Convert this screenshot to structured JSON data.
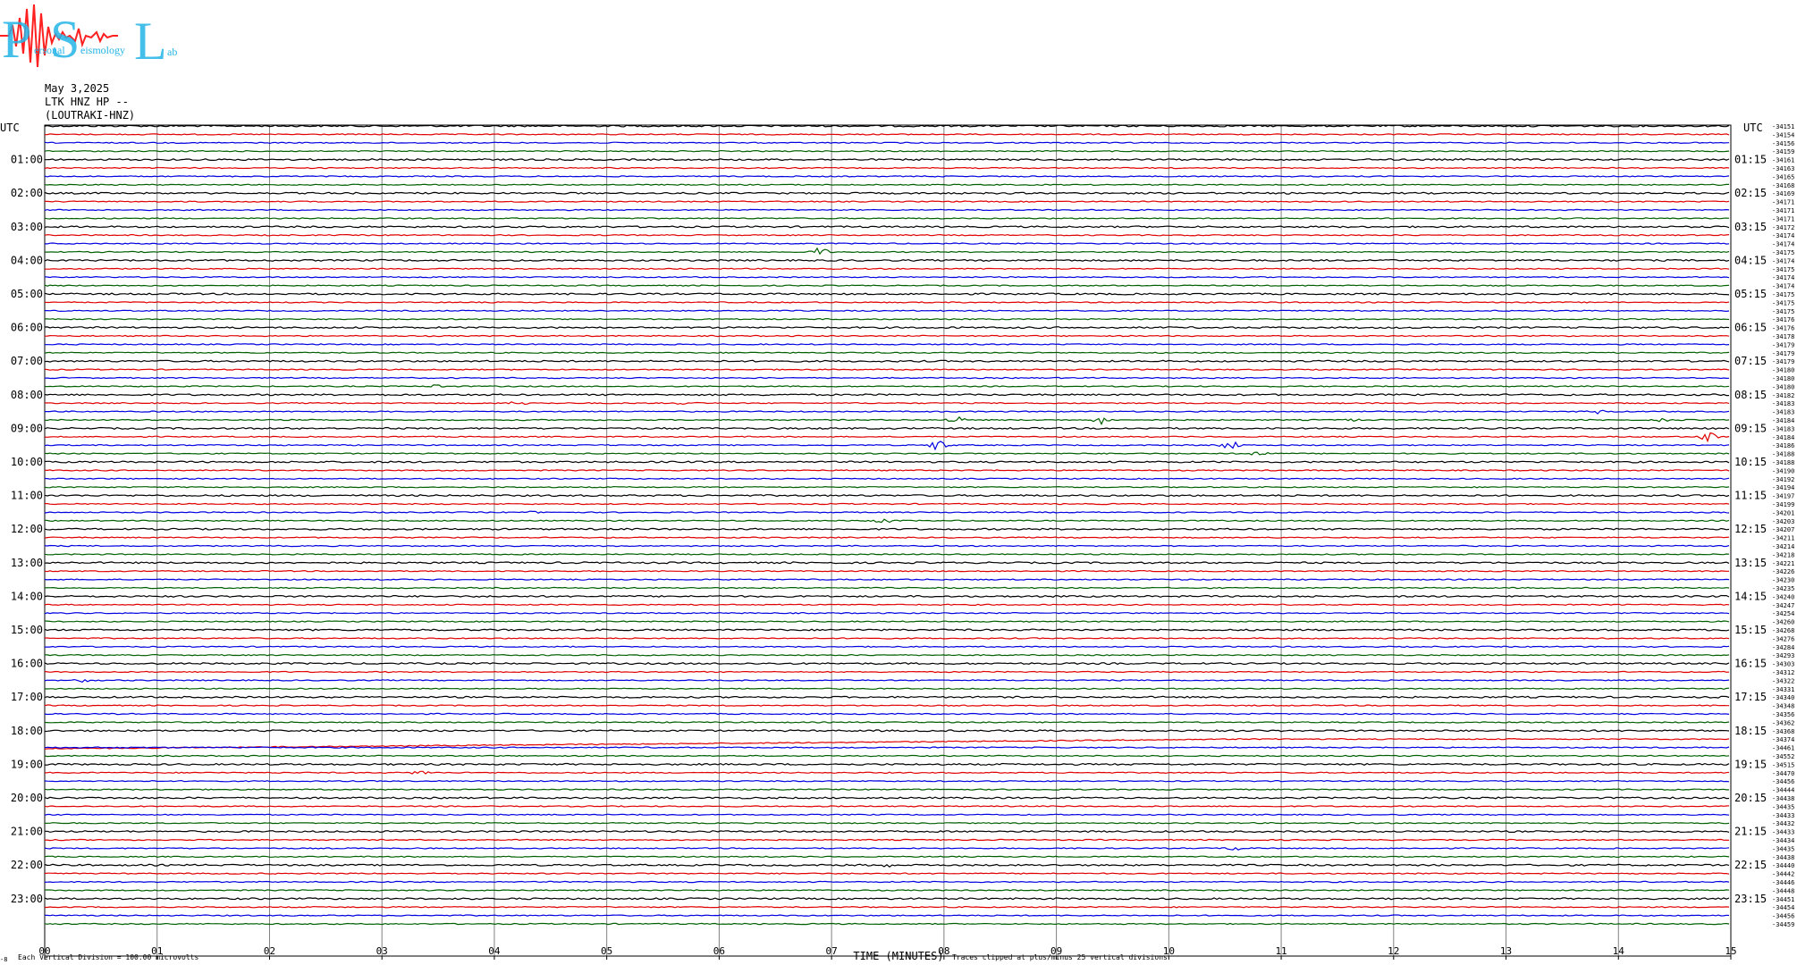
{
  "logo": {
    "letters": [
      "P",
      "S",
      "L"
    ],
    "words": [
      "ersonal",
      "eismology",
      "ab"
    ]
  },
  "header": {
    "date": "May 3,2025",
    "station": "LTK HNZ HP --",
    "location": "(LOUTRAKI-HNZ)"
  },
  "footer": {
    "xlabel": "TIME (MINUTES)",
    "scale_note": "Each Vertical Division =  100.00 microvolts",
    "clip_note": "Traces clipped at plus/minus 25 vertical divisions",
    "corner_mark": "-8"
  },
  "colors": {
    "cycle": [
      "#000000",
      "#e00000",
      "#0000e0",
      "#006000"
    ],
    "grid": "#808080",
    "logo_blue": "#22b4e6",
    "logo_red": "#ff2020"
  },
  "chart_data": {
    "type": "line",
    "subtype": "helicorder",
    "title": "",
    "xlabel": "TIME (MINUTES)",
    "ylabel": "",
    "xlim": [
      0,
      15
    ],
    "x_tick_labels": [
      "00",
      "01",
      "02",
      "03",
      "04",
      "05",
      "06",
      "07",
      "08",
      "09",
      "10",
      "11",
      "12",
      "13",
      "14",
      "15"
    ],
    "grid": true,
    "left_axis_header": "UTC",
    "right_axis_header": "UTC",
    "left_hour_labels": [
      "01:00",
      "02:00",
      "03:00",
      "04:00",
      "05:00",
      "06:00",
      "07:00",
      "08:00",
      "09:00",
      "10:00",
      "11:00",
      "12:00",
      "13:00",
      "14:00",
      "15:00",
      "16:00",
      "17:00",
      "18:00",
      "19:00",
      "20:00",
      "21:00",
      "22:00",
      "23:00"
    ],
    "right_hour_labels": [
      "01:15",
      "02:15",
      "03:15",
      "04:15",
      "05:15",
      "06:15",
      "07:15",
      "08:15",
      "09:15",
      "10:15",
      "11:15",
      "12:15",
      "13:15",
      "14:15",
      "15:15",
      "16:15",
      "17:15",
      "18:15",
      "19:15",
      "20:15",
      "21:15",
      "22:15",
      "23:15"
    ],
    "trace_count": 96,
    "trace_minutes": 15,
    "trace_offsets": [
      "-34151",
      "-34154",
      "-34156",
      "-34159",
      "-34161",
      "-34163",
      "-34165",
      "-34168",
      "-34169",
      "-34171",
      "-34171",
      "-34171",
      "-34172",
      "-34174",
      "-34174",
      "-34175",
      "-34174",
      "-34175",
      "-34174",
      "-34174",
      "-34175",
      "-34175",
      "-34175",
      "-34176",
      "-34176",
      "-34178",
      "-34179",
      "-34179",
      "-34179",
      "-34180",
      "-34180",
      "-34180",
      "-34182",
      "-34183",
      "-34183",
      "-34184",
      "-34183",
      "-34184",
      "-34186",
      "-34188",
      "-34188",
      "-34190",
      "-34192",
      "-34194",
      "-34197",
      "-34199",
      "-34201",
      "-34203",
      "-34207",
      "-34211",
      "-34214",
      "-34218",
      "-34221",
      "-34226",
      "-34230",
      "-34235",
      "-34240",
      "-34247",
      "-34254",
      "-34260",
      "-34268",
      "-34276",
      "-34284",
      "-34293",
      "-34303",
      "-34312",
      "-34322",
      "-34331",
      "-34340",
      "-34348",
      "-34356",
      "-34362",
      "-34368",
      "-34374",
      "-34461",
      "-34552",
      "-34515",
      "-34470",
      "-34456",
      "-34444",
      "-34438",
      "-34435",
      "-34433",
      "-34432",
      "-34433",
      "-34434",
      "-34435",
      "-34438",
      "-34440",
      "-34442",
      "-34446",
      "-34448",
      "-34451",
      "-34454",
      "-34456",
      "-34459"
    ],
    "events": [
      {
        "trace": 15,
        "minute": 6.9,
        "amplitude": 6
      },
      {
        "trace": 31,
        "minute": 3.5,
        "amplitude": 2
      },
      {
        "trace": 33,
        "minute": 4.2,
        "amplitude": 3
      },
      {
        "trace": 33,
        "minute": 5.7,
        "amplitude": 2
      },
      {
        "trace": 34,
        "minute": 13.8,
        "amplitude": 3
      },
      {
        "trace": 35,
        "minute": 8.1,
        "amplitude": 4
      },
      {
        "trace": 35,
        "minute": 9.4,
        "amplitude": 5
      },
      {
        "trace": 35,
        "minute": 11.6,
        "amplitude": 2
      },
      {
        "trace": 35,
        "minute": 14.4,
        "amplitude": 2
      },
      {
        "trace": 37,
        "minute": 14.8,
        "amplitude": 7
      },
      {
        "trace": 38,
        "minute": 7.95,
        "amplitude": 7
      },
      {
        "trace": 38,
        "minute": 10.55,
        "amplitude": 6
      },
      {
        "trace": 39,
        "minute": 10.8,
        "amplitude": 4
      },
      {
        "trace": 46,
        "minute": 4.3,
        "amplitude": 2
      },
      {
        "trace": 47,
        "minute": 7.45,
        "amplitude": 3
      },
      {
        "trace": 66,
        "minute": 0.35,
        "amplitude": 2
      },
      {
        "trace": 77,
        "minute": 3.35,
        "amplitude": 4
      },
      {
        "trace": 86,
        "minute": 10.6,
        "amplitude": 3
      },
      {
        "trace": 88,
        "minute": 7.5,
        "amplitude": 2
      }
    ],
    "drift": {
      "trace": 73,
      "start_offset_divisions": 12,
      "end_offset_divisions": 0
    }
  }
}
